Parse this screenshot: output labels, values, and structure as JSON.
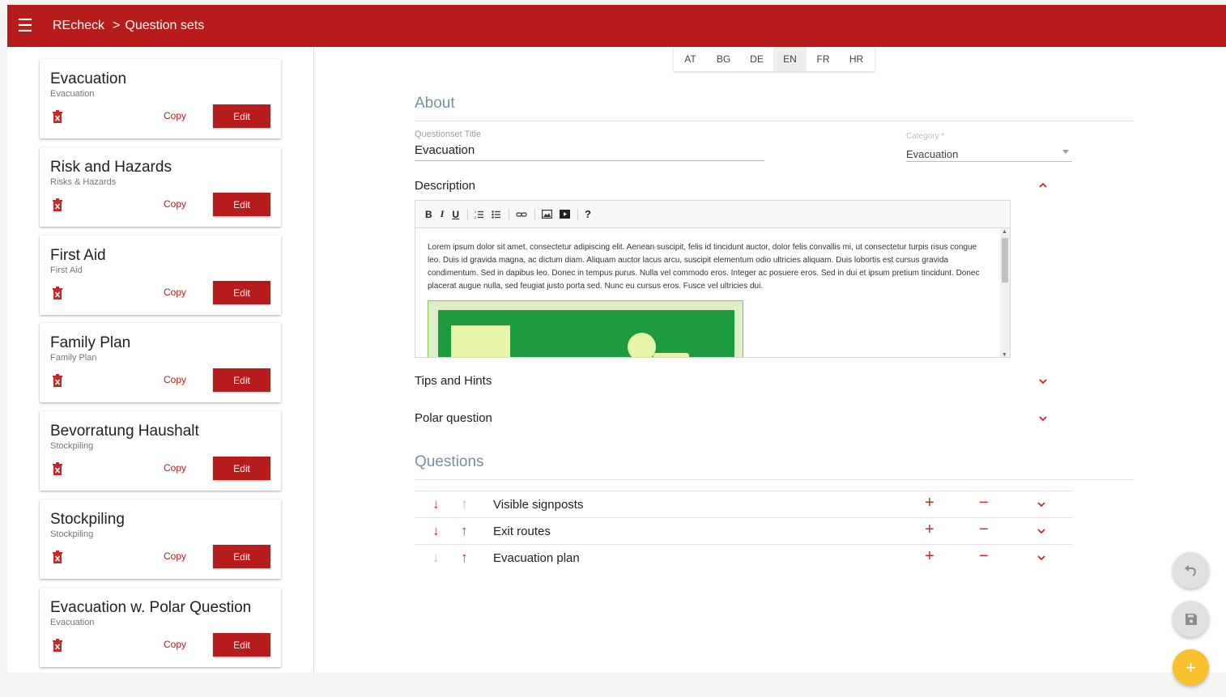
{
  "header": {
    "app_name": "REcheck",
    "separator": ">",
    "section": "Question sets"
  },
  "sidebar": {
    "copy_label": "Copy",
    "edit_label": "Edit",
    "cards": [
      {
        "title": "Evacuation",
        "subtitle": "Evacuation"
      },
      {
        "title": "Risk and Hazards",
        "subtitle": "Risks & Hazards"
      },
      {
        "title": "First Aid",
        "subtitle": "First Aid"
      },
      {
        "title": "Family Plan",
        "subtitle": "Family Plan"
      },
      {
        "title": "Bevorratung Haushalt",
        "subtitle": "Stockpiling"
      },
      {
        "title": "Stockpiling",
        "subtitle": "Stockpiling"
      },
      {
        "title": "Evacuation w. Polar Question",
        "subtitle": "Evacuation"
      }
    ]
  },
  "languages": {
    "items": [
      "AT",
      "BG",
      "DE",
      "EN",
      "FR",
      "HR"
    ],
    "active": "EN"
  },
  "about": {
    "heading": "About",
    "title_label": "Questionset Title",
    "title_value": "Evacuation",
    "category_label": "Category *",
    "category_value": "Evacuation"
  },
  "description": {
    "heading": "Description",
    "toolbar": [
      "B",
      "I",
      "U",
      "ordered-list",
      "bullet-list",
      "link",
      "image",
      "video",
      "?"
    ],
    "text": "Lorem ipsum dolor sit amet, consectetur adipiscing elit. Aenean suscipit, felis id tincidunt auctor, dolor felis convallis mi, ut consectetur turpis risus congue leo. Duis id gravida magna, ac dictum diam. Aliquam auctor lacus arcu, suscipit elementum odio ultricies aliquam. Duis lobortis est cursus gravida condimentum. Sed in dapibus leo. Donec in tempus purus. Nulla vel commodo eros. Integer ac posuere eros. Sed in dui et ipsum pretium tincidunt. Donec placerat augue nulla, sed feugiat justo porta sed. Nunc eu cursus eros. Fusce vel ultricies dui."
  },
  "panels": {
    "tips": "Tips and Hints",
    "polar": "Polar question"
  },
  "questions": {
    "heading": "Questions",
    "items": [
      {
        "label": "Visible signposts"
      },
      {
        "label": "Exit routes"
      },
      {
        "label": "Evacuation plan"
      }
    ]
  },
  "fab": {
    "add": "+"
  },
  "colors": {
    "primary": "#b71c1c",
    "accent": "#fbc02d"
  }
}
